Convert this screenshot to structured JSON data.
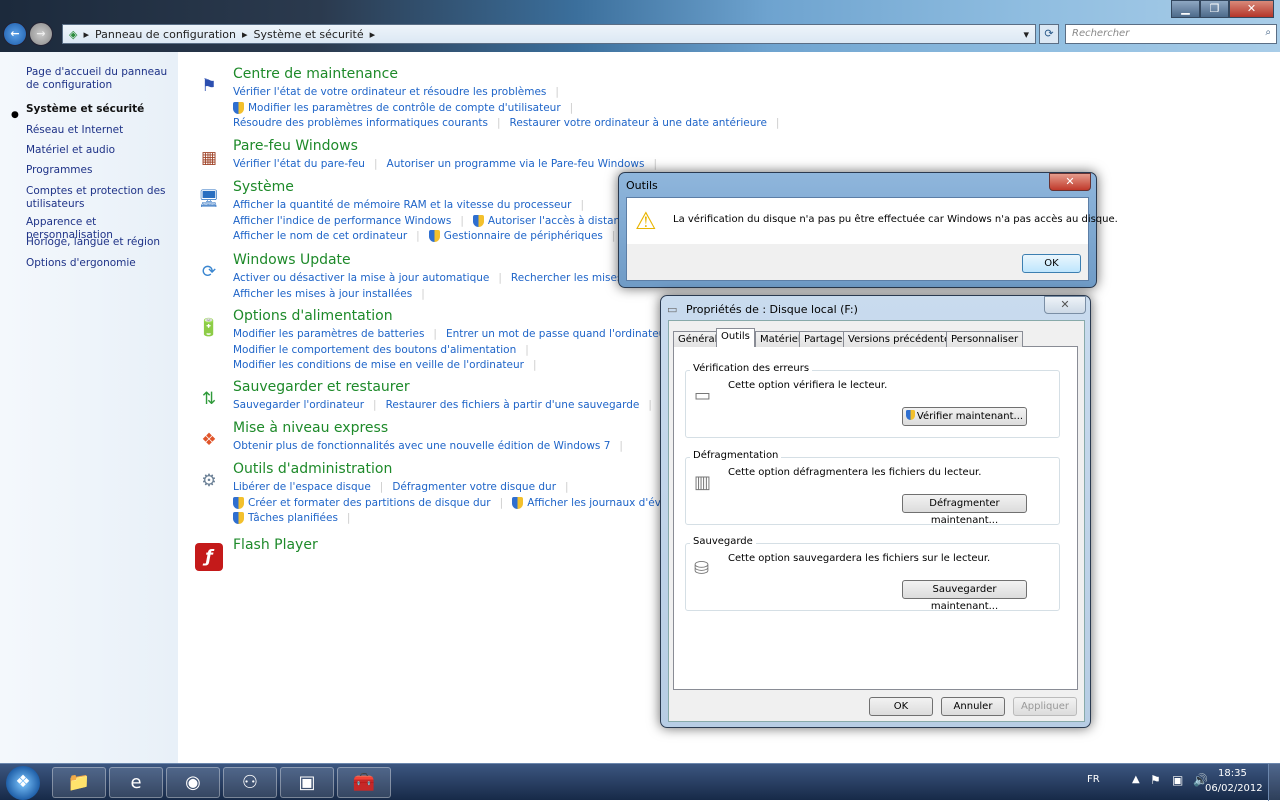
{
  "window": {
    "minimize": "▁",
    "maximize": "❐",
    "close": "✕"
  },
  "nav": {
    "back": "←",
    "forward": "→"
  },
  "breadcrumb": [
    "Panneau de configuration",
    "Système et sécurité"
  ],
  "search": {
    "placeholder": "Rechercher"
  },
  "sidebar": {
    "items": [
      {
        "label": "Page d'accueil du panneau de configuration"
      },
      {
        "label": "Système et sécurité",
        "active": true
      },
      {
        "label": "Réseau et Internet"
      },
      {
        "label": "Matériel et audio"
      },
      {
        "label": "Programmes"
      },
      {
        "label": "Comptes et protection des utilisateurs"
      },
      {
        "label": "Apparence et personnalisation"
      },
      {
        "label": "Horloge, langue et région"
      },
      {
        "label": "Options d'ergonomie"
      }
    ]
  },
  "sections": [
    {
      "title": "Centre de maintenance",
      "icon": "flag-icon",
      "glyph": "⚑",
      "color": "#2c4fb0",
      "rows": [
        [
          {
            "t": "Vérifier l'état de votre ordinateur et résoudre les problèmes"
          }
        ],
        [
          {
            "t": "Modifier les paramètres de contrôle de compte d'utilisateur",
            "s": true
          }
        ],
        [
          {
            "t": "Résoudre des problèmes informatiques courants"
          },
          {
            "t": "Restaurer votre ordinateur à une date antérieure"
          }
        ]
      ]
    },
    {
      "title": "Pare-feu Windows",
      "icon": "firewall-icon",
      "glyph": "▦",
      "color": "#a0452a",
      "rows": [
        [
          {
            "t": "Vérifier l'état du pare-feu"
          },
          {
            "t": "Autoriser un programme via le Pare-feu Windows"
          }
        ]
      ]
    },
    {
      "title": "Système",
      "icon": "computer-icon",
      "glyph": "🖥",
      "color": "#2a6fc0",
      "rows": [
        [
          {
            "t": "Afficher la quantité de mémoire RAM et la vitesse du processeur"
          }
        ],
        [
          {
            "t": "Afficher l'indice de performance Windows"
          },
          {
            "t": "Autoriser l'accès à distance",
            "s": true
          }
        ],
        [
          {
            "t": "Afficher le nom de cet ordinateur"
          },
          {
            "t": "Gestionnaire de périphériques",
            "s": true
          }
        ]
      ]
    },
    {
      "title": "Windows Update",
      "icon": "windows-update-icon",
      "glyph": "⟳",
      "color": "#3a86d0",
      "rows": [
        [
          {
            "t": "Activer ou désactiver la mise à jour automatique"
          },
          {
            "t": "Rechercher les mises à jour"
          }
        ],
        [
          {
            "t": "Afficher les mises à jour installées"
          }
        ]
      ]
    },
    {
      "title": "Options d'alimentation",
      "icon": "battery-icon",
      "glyph": "🔋",
      "color": "#2f9a3a",
      "rows": [
        [
          {
            "t": "Modifier les paramètres de batteries"
          },
          {
            "t": "Entrer un mot de passe quand l'ordinateur sort de veille"
          }
        ],
        [
          {
            "t": "Modifier le comportement des boutons d'alimentation"
          }
        ],
        [
          {
            "t": "Modifier les conditions de mise en veille de l'ordinateur"
          }
        ]
      ]
    },
    {
      "title": "Sauvegarder et restaurer",
      "icon": "backup-icon",
      "glyph": "⇅",
      "color": "#2f9a3a",
      "rows": [
        [
          {
            "t": "Sauvegarder l'ordinateur"
          },
          {
            "t": "Restaurer des fichiers à partir d'une sauvegarde"
          }
        ]
      ]
    },
    {
      "title": "Mise à niveau express",
      "icon": "windows-logo-icon",
      "glyph": "❖",
      "color": "#e0552a",
      "rows": [
        [
          {
            "t": "Obtenir plus de fonctionnalités avec une nouvelle édition de Windows 7"
          }
        ]
      ]
    },
    {
      "title": "Outils d'administration",
      "icon": "admin-tools-icon",
      "glyph": "⚙",
      "color": "#6a7f95",
      "rows": [
        [
          {
            "t": "Libérer de l'espace disque"
          },
          {
            "t": "Défragmenter votre disque dur"
          }
        ],
        [
          {
            "t": "Créer et formater des partitions de disque dur",
            "s": true
          },
          {
            "t": "Afficher les journaux d'événements",
            "s": true
          }
        ],
        [
          {
            "t": "Tâches planifiées",
            "s": true
          }
        ]
      ]
    },
    {
      "title": "Flash Player",
      "icon": "flash-player-icon",
      "glyph": "ƒ",
      "color": "#c41a1a",
      "rows": []
    }
  ],
  "alert": {
    "title": "Outils",
    "message": "La vérification du disque n'a pas pu être effectuée car Windows n'a pas accès au disque.",
    "ok": "OK"
  },
  "properties": {
    "title": "Propriétés de : Disque local (F:)",
    "tabs": [
      "Général",
      "Outils",
      "Matériel",
      "Partage",
      "Versions précédentes",
      "Personnaliser"
    ],
    "groups": [
      {
        "label": "Vérification des erreurs",
        "text": "Cette option vérifiera le lecteur.",
        "button": "Vérifier maintenant...",
        "shield": true,
        "icon": "drive-icon",
        "glyph": "▭"
      },
      {
        "label": "Défragmentation",
        "text": "Cette option défragmentera les fichiers du lecteur.",
        "button": "Défragmenter maintenant...",
        "icon": "defrag-icon",
        "glyph": "▥"
      },
      {
        "label": "Sauvegarde",
        "text": "Cette option sauvegardera les fichiers sur le lecteur.",
        "button": "Sauvegarder maintenant...",
        "icon": "backup-drive-icon",
        "glyph": "⛁"
      }
    ],
    "ok": "OK",
    "cancel": "Annuler",
    "apply": "Appliquer"
  },
  "taskbar": {
    "apps": [
      {
        "name": "explorer",
        "glyph": "📁"
      },
      {
        "name": "internet-explorer",
        "glyph": "e"
      },
      {
        "name": "firefox",
        "glyph": "◉"
      },
      {
        "name": "network",
        "glyph": "⚇"
      },
      {
        "name": "control-panel",
        "glyph": "▣"
      },
      {
        "name": "toolbox",
        "glyph": "🧰"
      }
    ],
    "lang": "FR",
    "time": "18:35",
    "date": "06/02/2012"
  }
}
